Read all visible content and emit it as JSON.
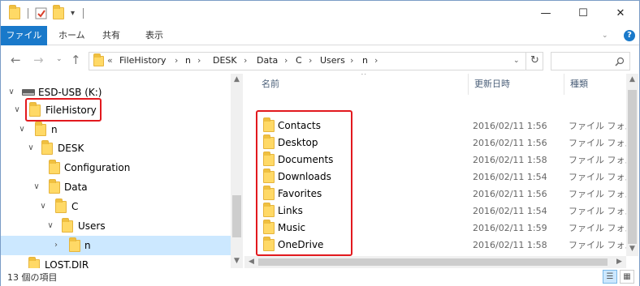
{
  "window": {
    "buttons": {
      "minimize": "—",
      "maximize": "☐",
      "close": "✕"
    }
  },
  "ribbon": {
    "tabs": [
      "ファイル",
      "ホーム",
      "共有",
      "表示"
    ],
    "help": "?"
  },
  "address_bar": {
    "overflow": "«",
    "breadcrumbs": [
      "FileHistory",
      "n",
      "DESK",
      "Data",
      "C",
      "Users",
      "n"
    ],
    "separator": "›"
  },
  "nav_tree": [
    {
      "label": "ESD-USB (K:)",
      "type": "drive",
      "expanded": true
    },
    {
      "label": "FileHistory",
      "type": "folder",
      "expanded": true,
      "highlighted": true
    },
    {
      "label": "n",
      "type": "folder",
      "expanded": true
    },
    {
      "label": "DESK",
      "type": "folder",
      "expanded": true
    },
    {
      "label": "Configuration",
      "type": "folder",
      "expanded": null
    },
    {
      "label": "Data",
      "type": "folder",
      "expanded": true
    },
    {
      "label": "C",
      "type": "folder",
      "expanded": true
    },
    {
      "label": "Users",
      "type": "folder",
      "expanded": true
    },
    {
      "label": "n",
      "type": "folder",
      "expanded": false,
      "selected": true
    },
    {
      "label": "LOST.DIR",
      "type": "folder",
      "expanded": null
    }
  ],
  "columns": {
    "name": "名前",
    "date": "更新日時",
    "type": "種類"
  },
  "files": [
    {
      "name": "Contacts",
      "date": "2016/02/11 1:56",
      "type": "ファイル フォルダー"
    },
    {
      "name": "Desktop",
      "date": "2016/02/11 1:56",
      "type": "ファイル フォルダー"
    },
    {
      "name": "Documents",
      "date": "2016/02/11 1:58",
      "type": "ファイル フォルダー"
    },
    {
      "name": "Downloads",
      "date": "2016/02/11 1:54",
      "type": "ファイル フォルダー"
    },
    {
      "name": "Favorites",
      "date": "2016/02/11 1:56",
      "type": "ファイル フォルダー"
    },
    {
      "name": "Links",
      "date": "2016/02/11 1:54",
      "type": "ファイル フォルダー"
    },
    {
      "name": "Music",
      "date": "2016/02/11 1:59",
      "type": "ファイル フォルダー"
    },
    {
      "name": "OneDrive",
      "date": "2016/02/11 1:58",
      "type": "ファイル フォルダー"
    }
  ],
  "status": {
    "item_count": "13 個の項目"
  },
  "colors": {
    "accent": "#1979ca",
    "highlight": "#e2191e",
    "selection": "#cce8ff",
    "folder": "#ffd966"
  }
}
